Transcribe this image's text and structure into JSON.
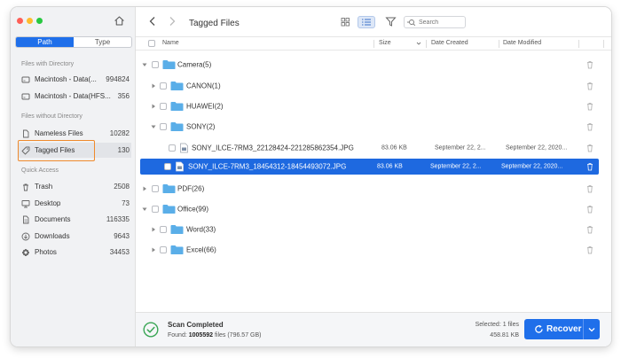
{
  "sidebar": {
    "tabs": [
      {
        "label": "Path"
      },
      {
        "label": "Type"
      }
    ],
    "sections": [
      {
        "title": "Files with Directory"
      },
      {
        "title": "Files without Directory"
      },
      {
        "title": "Quick Access"
      }
    ],
    "items": [
      {
        "label": "Macintosh - Data(...",
        "count": "994824",
        "icon": "drive-icon"
      },
      {
        "label": "Macintosh - Data(HFS...",
        "count": "356",
        "icon": "drive-icon"
      },
      {
        "label": "Nameless Files",
        "count": "10282",
        "icon": "document-icon"
      },
      {
        "label": "Tagged Files",
        "count": "130",
        "icon": "tag-icon"
      },
      {
        "label": "Trash",
        "count": "2508",
        "icon": "trash-icon"
      },
      {
        "label": "Desktop",
        "count": "73",
        "icon": "desktop-icon"
      },
      {
        "label": "Documents",
        "count": "116335",
        "icon": "document-icon"
      },
      {
        "label": "Downloads",
        "count": "9643",
        "icon": "download-icon"
      },
      {
        "label": "Photos",
        "count": "34453",
        "icon": "photos-icon"
      }
    ]
  },
  "toolbar": {
    "title": "Tagged Files",
    "search_placeholder": "Search"
  },
  "columns": {
    "name": "Name",
    "size": "Size",
    "created": "Date Created",
    "modified": "Date Modified"
  },
  "rows": [
    {
      "name": "Camera(5)",
      "type": "folder",
      "expanded": true
    },
    {
      "name": "CANON(1)",
      "type": "folder",
      "expanded": false
    },
    {
      "name": "HUAWEI(2)",
      "type": "folder",
      "expanded": false
    },
    {
      "name": "SONY(2)",
      "type": "folder",
      "expanded": true
    },
    {
      "name": "SONY_ILCE-7RM3_22128424-221285862354.JPG",
      "type": "file",
      "size": "83.06 KB",
      "created": "September 22, 2...",
      "modified": "September 22, 2020..."
    },
    {
      "name": "SONY_ILCE-7RM3_18454312-18454493072.JPG",
      "type": "file",
      "size": "83.06 KB",
      "created": "September 22, 2...",
      "modified": "September 22, 2020...",
      "selected": true
    },
    {
      "name": "PDF(26)",
      "type": "folder",
      "expanded": false
    },
    {
      "name": "Office(99)",
      "type": "folder",
      "expanded": true
    },
    {
      "name": "Word(33)",
      "type": "folder",
      "expanded": false
    },
    {
      "name": "Excel(66)",
      "type": "folder",
      "expanded": false
    }
  ],
  "status": {
    "title": "Scan Completed",
    "found_prefix": "Found: ",
    "found_count": "1005592",
    "found_suffix": " files (796.57 GB)",
    "selected": "Selected: 1 files",
    "selected_size": "458.81 KB",
    "recover_label": "Recover"
  },
  "colors": {
    "accent": "#1f6fea",
    "selection": "#1e69e0",
    "highlight": "#ef8a2c",
    "folder": "#5aaee8",
    "success": "#3aa655"
  }
}
